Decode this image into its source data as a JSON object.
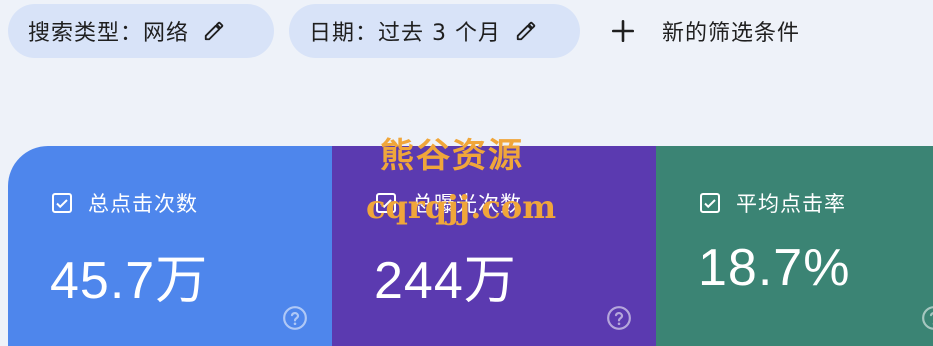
{
  "filters": {
    "search_type": "搜索类型：网络",
    "date": "日期：过去 3 个月",
    "add_filter": "新的筛选条件"
  },
  "metrics": {
    "clicks": {
      "label": "总点击次数",
      "value": "45.7万",
      "color": "#4e86ec",
      "checked": true
    },
    "impressions": {
      "label": "总曝光次数",
      "value": "244万",
      "color": "#5b3ab0",
      "checked": true
    },
    "ctr": {
      "label": "平均点击率",
      "value": "18.7%",
      "color": "#3b8474",
      "checked": true
    }
  },
  "watermark": {
    "line1": "熊谷资源",
    "line2": "cqrqjj.com"
  },
  "icons": {
    "edit": "pencil-icon",
    "add": "plus-icon",
    "checkbox": "checkbox-checked-icon",
    "help": "help-circle-icon"
  }
}
